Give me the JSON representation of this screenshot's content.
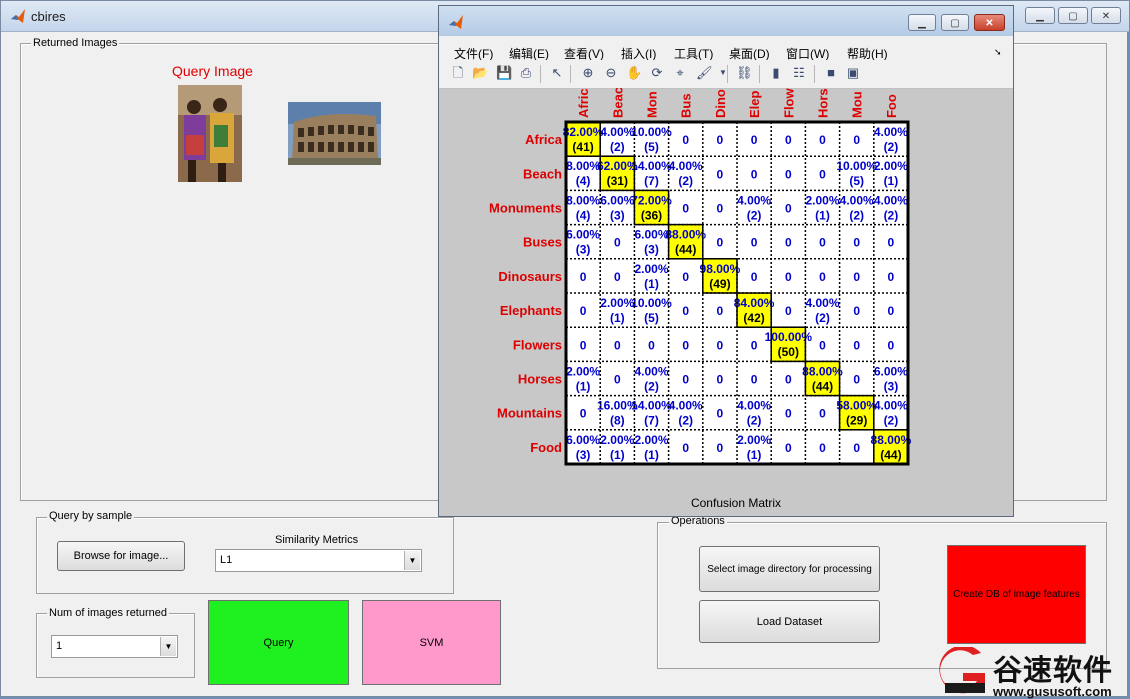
{
  "main_window": {
    "title": "cbires",
    "panel_returned_images": "Returned Images",
    "query_image_label": "Query Image",
    "panel_query_by_sample": "Query by sample",
    "browse_button": "Browse for image...",
    "similarity_metrics_label": "Similarity Metrics",
    "similarity_metric_value": "L1",
    "panel_num_returned": "Num of images returned",
    "num_returned_value": "1",
    "query_button": "Query",
    "svm_button": "SVM",
    "panel_operations": "Operations",
    "select_dir_button": "Select image directory for processing",
    "load_dataset_button": "Load Dataset",
    "create_db_button": "Create DB of image features",
    "query_color": "#1ff01f",
    "svm_color": "#ff99cc",
    "create_db_color": "#ff0000"
  },
  "figure_window": {
    "menus": [
      "文件(F)",
      "编辑(E)",
      "查看(V)",
      "插入(I)",
      "工具(T)",
      "桌面(D)",
      "窗口(W)",
      "帮助(H)"
    ],
    "toolbar_icons": [
      "new-icon",
      "open-icon",
      "save-icon",
      "print-icon",
      "pointer-icon",
      "zoom-in-icon",
      "zoom-out-icon",
      "pan-icon",
      "rotate-icon",
      "data-cursor-icon",
      "brush-icon",
      "link-icon",
      "colorbar-icon",
      "legend-icon",
      "hide-plot-tools-icon",
      "show-plot-tools-icon"
    ]
  },
  "chart_data": {
    "type": "heatmap",
    "title": "Confusion Matrix",
    "col_labels": [
      "Afric",
      "Beac",
      "Mon",
      "Bus",
      "Dino",
      "Elep",
      "Flow",
      "Hors",
      "Mou",
      "Foo"
    ],
    "row_labels": [
      "Africa",
      "Beach",
      "Monuments",
      "Buses",
      "Dinosaurs",
      "Elephants",
      "Flowers",
      "Horses",
      "Mountains",
      "Food"
    ],
    "diagonal_color": "#ffff00",
    "label_color": "#dd0000",
    "value_color": "#0000cc",
    "cells": [
      [
        [
          "82.00%",
          "(41)"
        ],
        [
          "4.00%",
          "(2)"
        ],
        [
          "10.00%",
          "(5)"
        ],
        [
          "0",
          ""
        ],
        [
          "0",
          ""
        ],
        [
          "0",
          ""
        ],
        [
          "0",
          ""
        ],
        [
          "0",
          ""
        ],
        [
          "0",
          ""
        ],
        [
          "4.00%",
          "(2)"
        ]
      ],
      [
        [
          "8.00%",
          "(4)"
        ],
        [
          "62.00%",
          "(31)"
        ],
        [
          "14.00%",
          "(7)"
        ],
        [
          "4.00%",
          "(2)"
        ],
        [
          "0",
          ""
        ],
        [
          "0",
          ""
        ],
        [
          "0",
          ""
        ],
        [
          "0",
          ""
        ],
        [
          "10.00%",
          "(5)"
        ],
        [
          "2.00%",
          "(1)"
        ]
      ],
      [
        [
          "8.00%",
          "(4)"
        ],
        [
          "6.00%",
          "(3)"
        ],
        [
          "72.00%",
          "(36)"
        ],
        [
          "0",
          ""
        ],
        [
          "0",
          ""
        ],
        [
          "4.00%",
          "(2)"
        ],
        [
          "0",
          ""
        ],
        [
          "2.00%",
          "(1)"
        ],
        [
          "4.00%",
          "(2)"
        ],
        [
          "4.00%",
          "(2)"
        ]
      ],
      [
        [
          "6.00%",
          "(3)"
        ],
        [
          "0",
          ""
        ],
        [
          "6.00%",
          "(3)"
        ],
        [
          "88.00%",
          "(44)"
        ],
        [
          "0",
          ""
        ],
        [
          "0",
          ""
        ],
        [
          "0",
          ""
        ],
        [
          "0",
          ""
        ],
        [
          "0",
          ""
        ],
        [
          "0",
          ""
        ]
      ],
      [
        [
          "0",
          ""
        ],
        [
          "0",
          ""
        ],
        [
          "2.00%",
          "(1)"
        ],
        [
          "0",
          ""
        ],
        [
          "98.00%",
          "(49)"
        ],
        [
          "0",
          ""
        ],
        [
          "0",
          ""
        ],
        [
          "0",
          ""
        ],
        [
          "0",
          ""
        ],
        [
          "0",
          ""
        ]
      ],
      [
        [
          "0",
          ""
        ],
        [
          "2.00%",
          "(1)"
        ],
        [
          "10.00%",
          "(5)"
        ],
        [
          "0",
          ""
        ],
        [
          "0",
          ""
        ],
        [
          "84.00%",
          "(42)"
        ],
        [
          "0",
          ""
        ],
        [
          "4.00%",
          "(2)"
        ],
        [
          "0",
          ""
        ],
        [
          "0",
          ""
        ]
      ],
      [
        [
          "0",
          ""
        ],
        [
          "0",
          ""
        ],
        [
          "0",
          ""
        ],
        [
          "0",
          ""
        ],
        [
          "0",
          ""
        ],
        [
          "0",
          ""
        ],
        [
          "100.00%",
          "(50)"
        ],
        [
          "0",
          ""
        ],
        [
          "0",
          ""
        ],
        [
          "0",
          ""
        ]
      ],
      [
        [
          "2.00%",
          "(1)"
        ],
        [
          "0",
          ""
        ],
        [
          "4.00%",
          "(2)"
        ],
        [
          "0",
          ""
        ],
        [
          "0",
          ""
        ],
        [
          "0",
          ""
        ],
        [
          "0",
          ""
        ],
        [
          "88.00%",
          "(44)"
        ],
        [
          "0",
          ""
        ],
        [
          "6.00%",
          "(3)"
        ]
      ],
      [
        [
          "0",
          ""
        ],
        [
          "16.00%",
          "(8)"
        ],
        [
          "14.00%",
          "(7)"
        ],
        [
          "4.00%",
          "(2)"
        ],
        [
          "0",
          ""
        ],
        [
          "4.00%",
          "(2)"
        ],
        [
          "0",
          ""
        ],
        [
          "0",
          ""
        ],
        [
          "58.00%",
          "(29)"
        ],
        [
          "4.00%",
          "(2)"
        ]
      ],
      [
        [
          "6.00%",
          "(3)"
        ],
        [
          "2.00%",
          "(1)"
        ],
        [
          "2.00%",
          "(1)"
        ],
        [
          "0",
          ""
        ],
        [
          "0",
          ""
        ],
        [
          "2.00%",
          "(1)"
        ],
        [
          "0",
          ""
        ],
        [
          "0",
          ""
        ],
        [
          "0",
          ""
        ],
        [
          "88.00%",
          "(44)"
        ]
      ]
    ]
  },
  "watermark": {
    "brand": "谷速软件",
    "url": "www.gususoft.com"
  }
}
